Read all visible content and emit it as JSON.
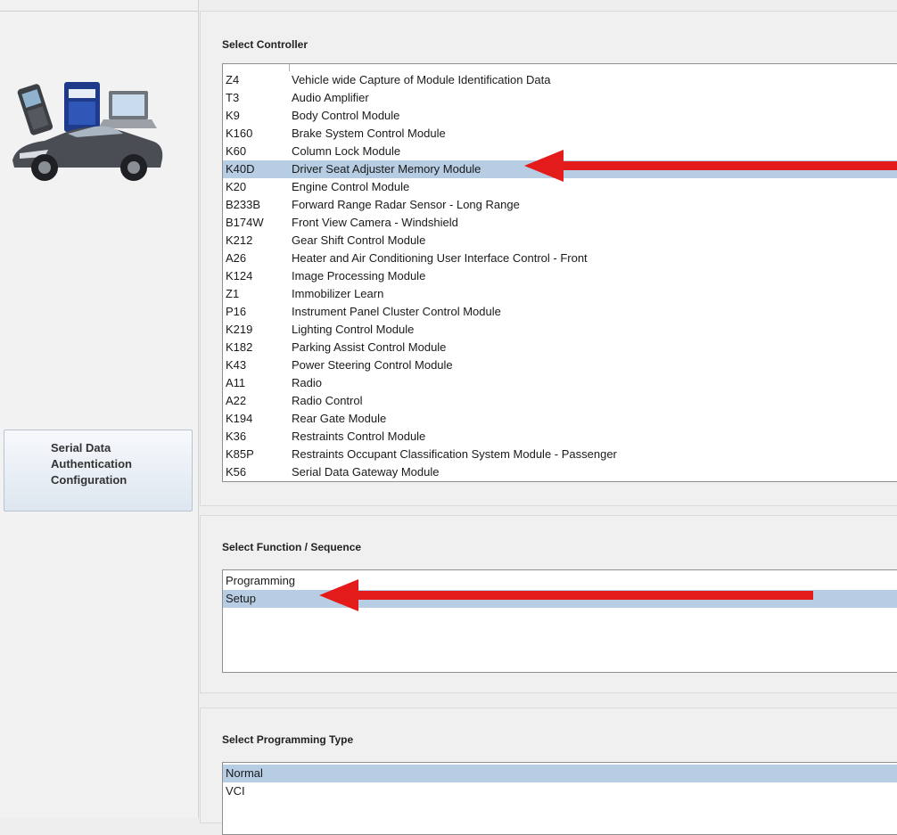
{
  "sidebar": {
    "nav_item_label": "Serial Data Authentication Configuration"
  },
  "controller": {
    "title": "Select Controller",
    "modules": [
      {
        "code": "Z4",
        "name": "Vehicle wide Capture of Module Identification Data"
      },
      {
        "code": "T3",
        "name": "Audio Amplifier"
      },
      {
        "code": "K9",
        "name": "Body Control Module"
      },
      {
        "code": "K160",
        "name": "Brake System Control Module"
      },
      {
        "code": "K60",
        "name": "Column Lock Module"
      },
      {
        "code": "K40D",
        "name": "Driver Seat Adjuster Memory Module"
      },
      {
        "code": "K20",
        "name": "Engine Control Module"
      },
      {
        "code": "B233B",
        "name": "Forward Range Radar Sensor - Long Range"
      },
      {
        "code": "B174W",
        "name": "Front View Camera - Windshield"
      },
      {
        "code": "K212",
        "name": "Gear Shift Control Module"
      },
      {
        "code": "A26",
        "name": "Heater and Air Conditioning User Interface Control - Front"
      },
      {
        "code": "K124",
        "name": "Image Processing Module"
      },
      {
        "code": "Z1",
        "name": "Immobilizer Learn"
      },
      {
        "code": "P16",
        "name": "Instrument Panel Cluster Control Module"
      },
      {
        "code": "K219",
        "name": "Lighting Control Module"
      },
      {
        "code": "K182",
        "name": "Parking Assist Control Module"
      },
      {
        "code": "K43",
        "name": "Power Steering Control Module"
      },
      {
        "code": "A11",
        "name": "Radio"
      },
      {
        "code": "A22",
        "name": "Radio Control"
      },
      {
        "code": "K194",
        "name": "Rear Gate Module"
      },
      {
        "code": "K36",
        "name": "Restraints Control Module"
      },
      {
        "code": "K85P",
        "name": "Restraints Occupant Classification System Module - Passenger"
      },
      {
        "code": "K56",
        "name": "Serial Data Gateway Module"
      }
    ],
    "selected_code": "K40D"
  },
  "function": {
    "title": "Select Function / Sequence",
    "options": [
      "Programming",
      "Setup"
    ],
    "selected": "Setup"
  },
  "programming_type": {
    "title": "Select Programming Type",
    "options": [
      "Normal",
      "VCI"
    ],
    "selected": "Normal"
  },
  "colors": {
    "selection": "#b7cde3",
    "arrow": "#e41b1b"
  }
}
